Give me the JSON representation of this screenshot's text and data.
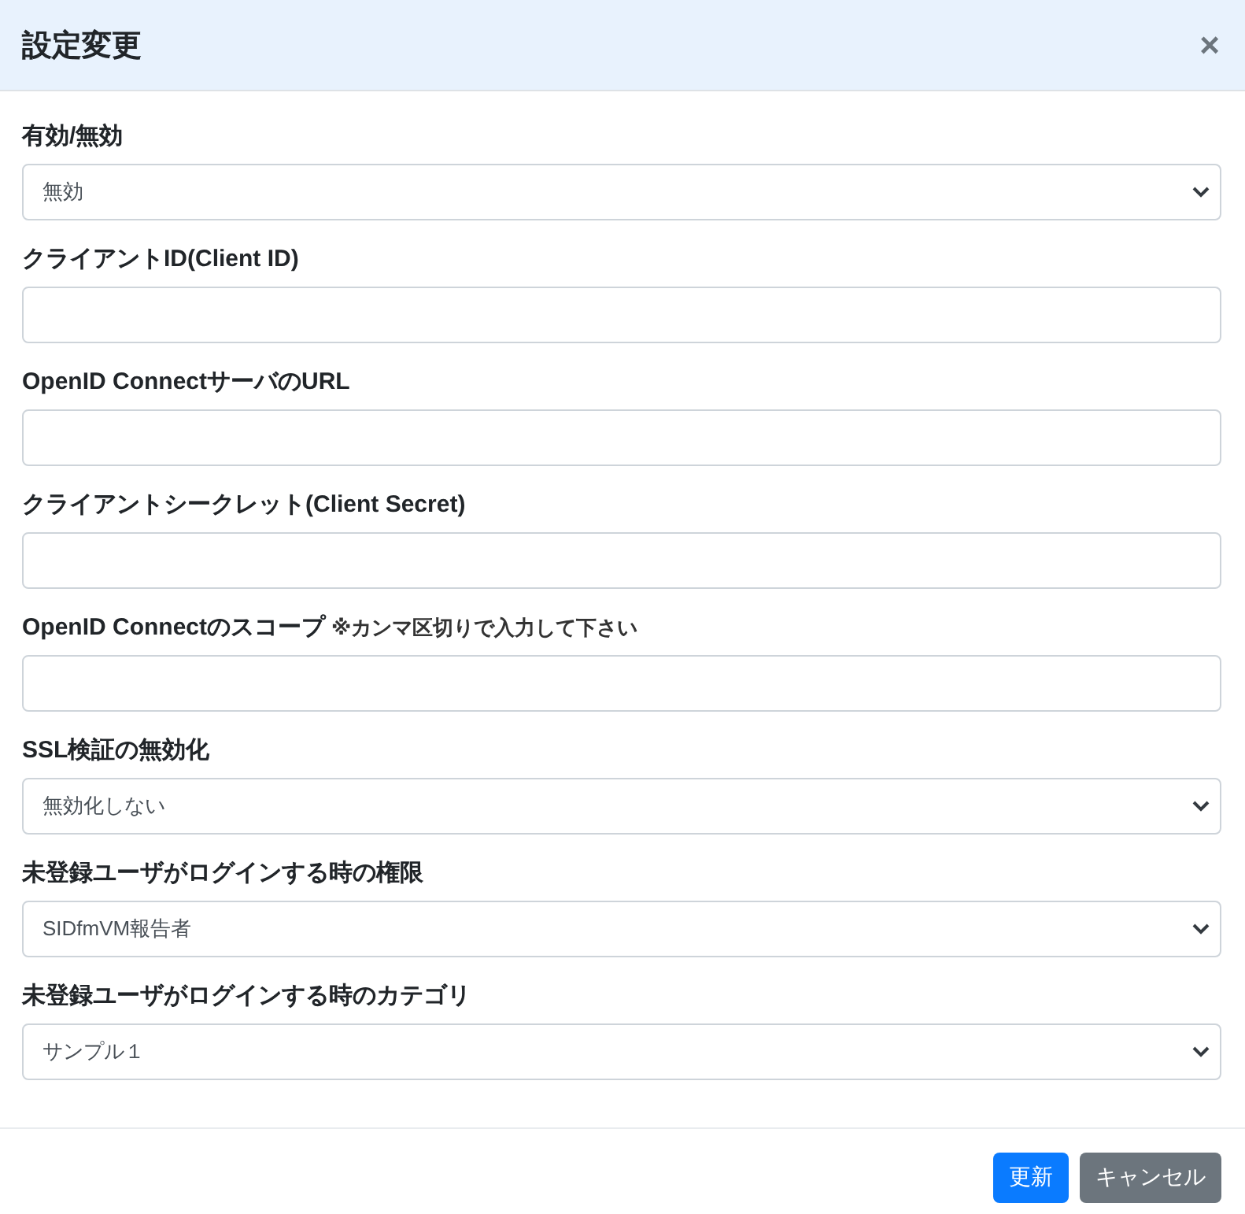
{
  "dialog": {
    "title": "設定変更",
    "close": "×"
  },
  "fields": [
    {
      "kind": "select",
      "label": "有効/無効",
      "value": "無効"
    },
    {
      "kind": "text",
      "label": "クライアントID(Client ID)"
    },
    {
      "kind": "text",
      "label": "OpenID ConnectサーバのURL"
    },
    {
      "kind": "text",
      "label": "クライアントシークレット(Client Secret)"
    },
    {
      "kind": "text",
      "label": "OpenID Connectのスコープ",
      "note": "※カンマ区切りで入力して下さい"
    },
    {
      "kind": "select",
      "label": "SSL検証の無効化",
      "value": "無効化しない"
    },
    {
      "kind": "select",
      "label": "未登録ユーザがログインする時の権限",
      "value": "SIDfmVM報告者"
    },
    {
      "kind": "select",
      "label": "未登録ユーザがログインする時のカテゴリ",
      "value": "サンプル１"
    }
  ],
  "buttons": [
    {
      "kind": "primary",
      "label": "更新"
    },
    {
      "kind": "secondary",
      "label": "キャンセル"
    }
  ]
}
